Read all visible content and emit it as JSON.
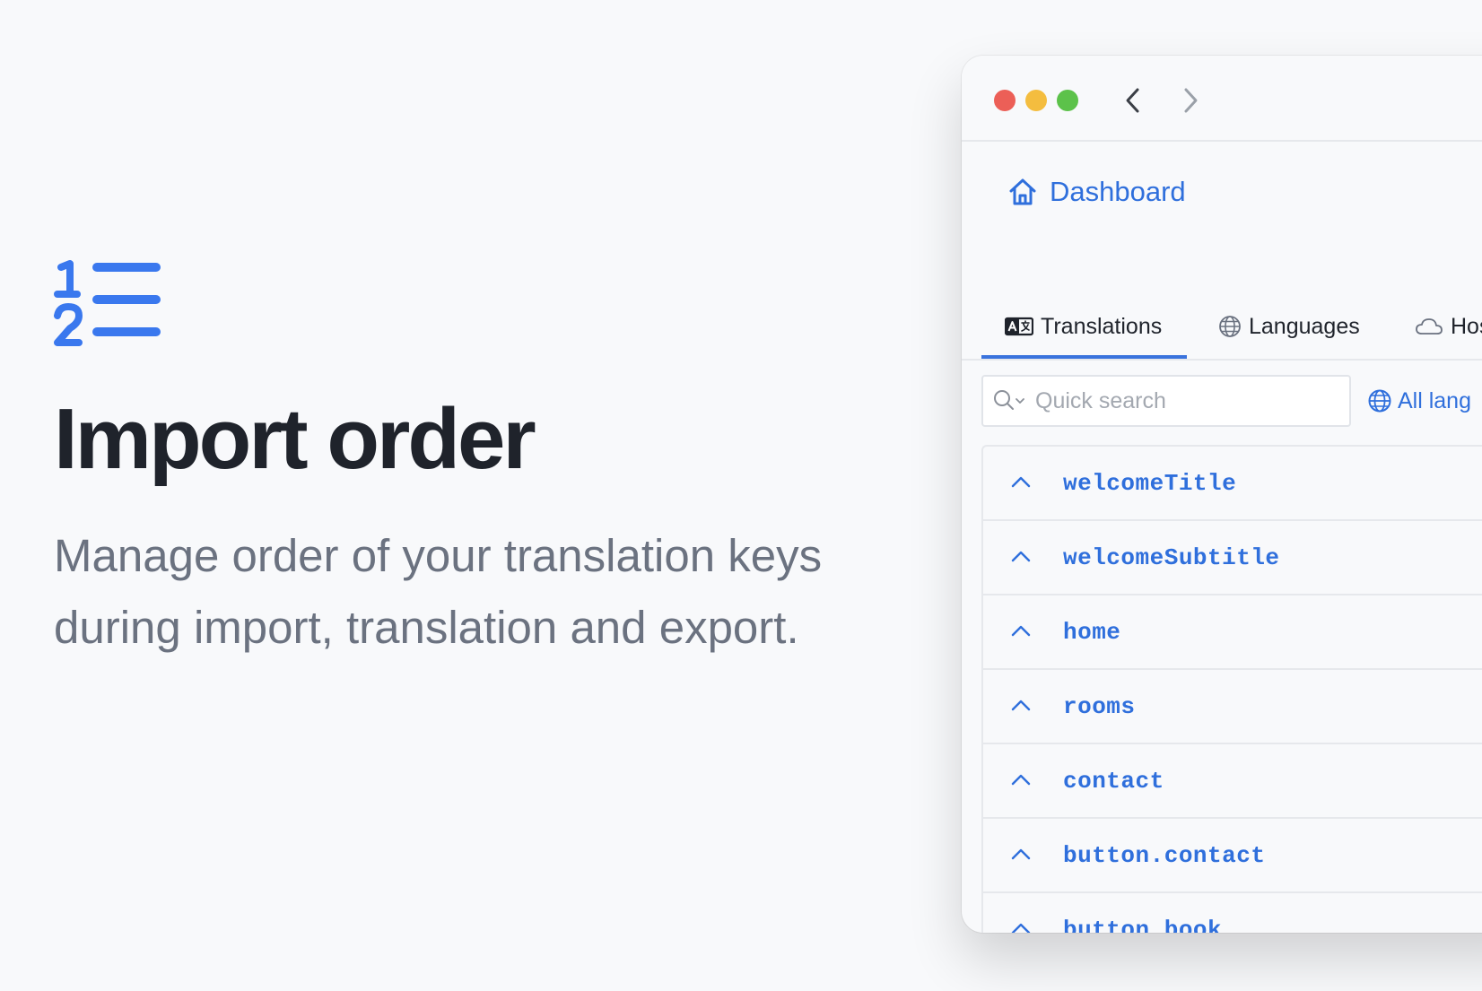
{
  "hero": {
    "icon": "numbered-list-icon",
    "title": "Import order",
    "description_line1": "Manage order of your translation keys",
    "description_line2": "during import, translation and export."
  },
  "window": {
    "nav": {
      "back_icon": "chevron-left-icon",
      "forward_icon": "chevron-right-icon"
    },
    "dashboard": {
      "icon": "home-icon",
      "label": "Dashboard"
    },
    "tabs": [
      {
        "label": "Translations",
        "icon": "translate-icon",
        "active": true
      },
      {
        "label": "Languages",
        "icon": "globe-icon",
        "active": false
      },
      {
        "label": "Hos",
        "icon": "cloud-icon",
        "active": false
      }
    ],
    "search": {
      "placeholder": "Quick search",
      "value": ""
    },
    "language_filter": {
      "icon": "globe-icon",
      "label": "All lang"
    },
    "keys": [
      {
        "key": "welcomeTitle"
      },
      {
        "key": "welcomeSubtitle"
      },
      {
        "key": "home"
      },
      {
        "key": "rooms"
      },
      {
        "key": "contact"
      },
      {
        "key": "button.contact"
      },
      {
        "key": "button.book"
      }
    ]
  },
  "colors": {
    "accent": "#2f6fdc",
    "background": "#f8f9fb",
    "title_text": "#1f232b",
    "muted_text": "#6b7280"
  }
}
